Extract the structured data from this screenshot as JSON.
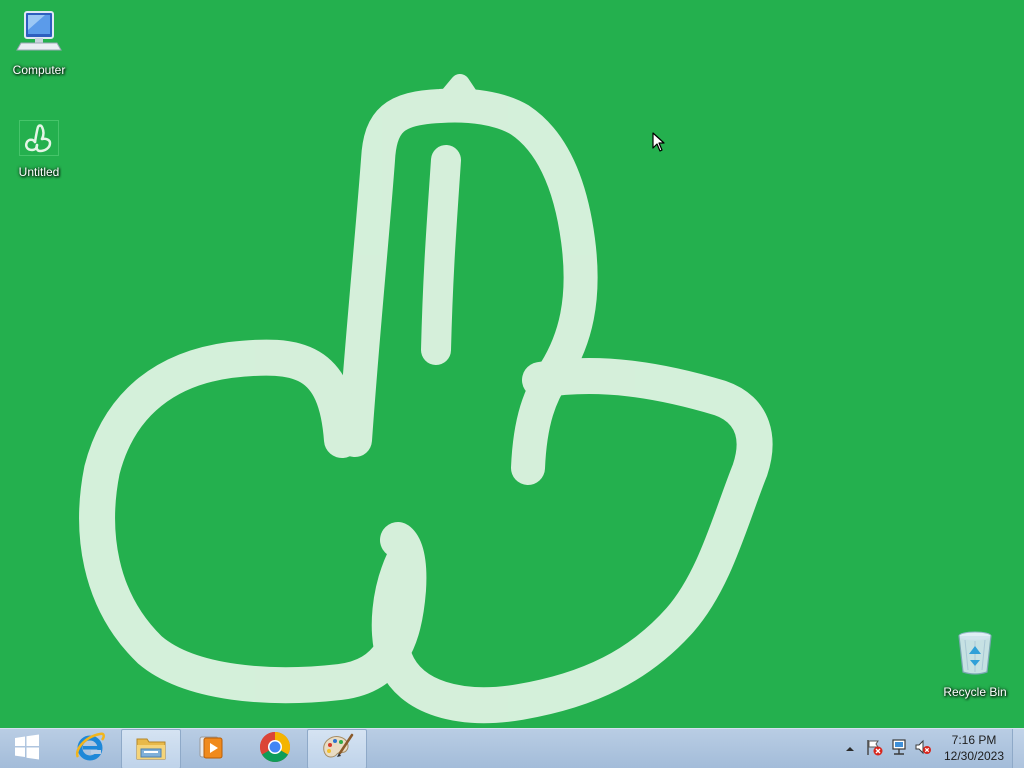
{
  "desktop": {
    "background_color": "#24b04e",
    "icons": [
      {
        "label": "Computer",
        "icon": "computer-icon"
      },
      {
        "label": "Untitled",
        "icon": "paint-file-icon"
      },
      {
        "label": "Recycle Bin",
        "icon": "recycle-bin-icon"
      }
    ]
  },
  "taskbar": {
    "start": {
      "icon": "windows-start-icon"
    },
    "pinned": [
      {
        "name": "Internet Explorer",
        "icon": "internet-explorer-icon",
        "active": false
      },
      {
        "name": "File Explorer",
        "icon": "file-explorer-icon",
        "active": true
      },
      {
        "name": "Windows Media Player",
        "icon": "media-player-icon",
        "active": false
      },
      {
        "name": "Google Chrome",
        "icon": "chrome-icon",
        "active": false
      },
      {
        "name": "Paint",
        "icon": "paint-icon",
        "active": true
      }
    ],
    "tray": {
      "icons": [
        "show-hidden-icons-chevron-icon",
        "action-center-flag-icon",
        "network-icon",
        "volume-muted-icon"
      ],
      "time": "7:16 PM",
      "date": "12/30/2023"
    }
  }
}
